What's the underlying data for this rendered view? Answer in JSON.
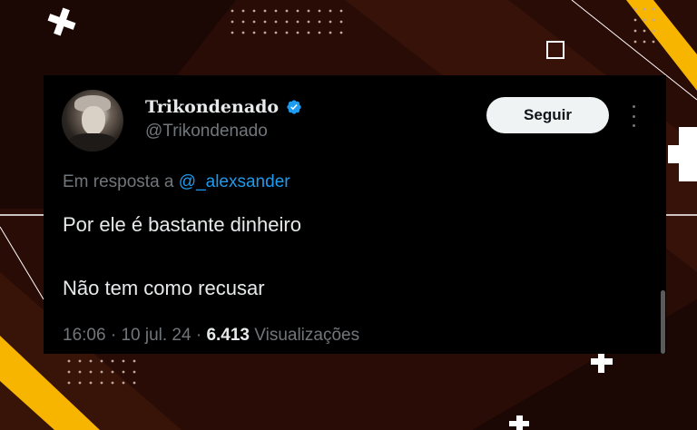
{
  "tweet": {
    "display_name": "Trikondenado",
    "handle": "@Trikondenado",
    "follow_label": "Seguir",
    "reply_prefix": "Em resposta a",
    "reply_mention": "@_alexsander",
    "text_line_1": "Por ele é bastante dinheiro",
    "text_line_2": "Não tem como recusar",
    "time": "16:06",
    "date": "10 jul. 24",
    "separator": "·",
    "views_count": "6.413",
    "views_label": "Visualizações"
  },
  "icons": {
    "verified": "verified-badge-icon",
    "more": "more-vertical-icon"
  },
  "colors": {
    "background": "#2a0c06",
    "accent_yellow": "#f7b500",
    "card": "#000000",
    "verified_blue": "#1d9bf0",
    "muted_text": "#71767b",
    "primary_text": "#e7e9ea"
  }
}
